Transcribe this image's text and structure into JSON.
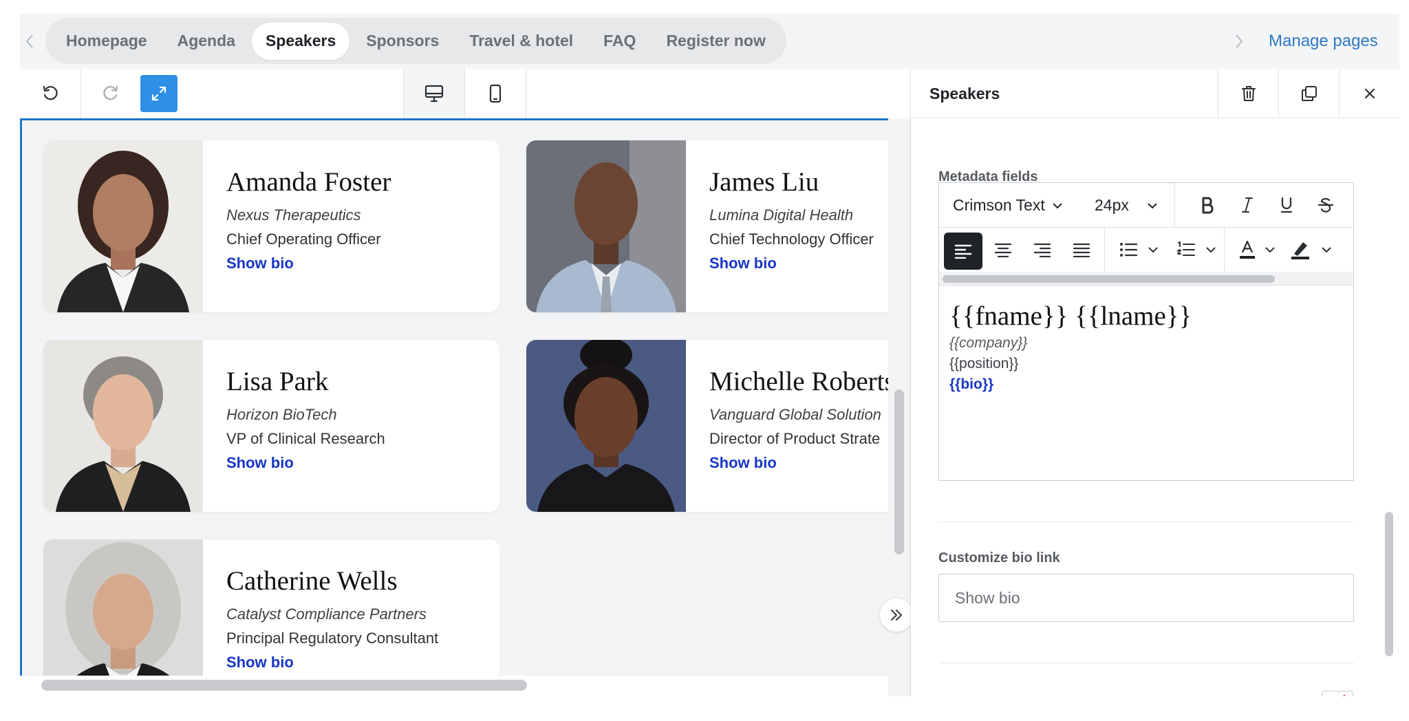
{
  "topnav": {
    "tabs": [
      {
        "label": "Homepage"
      },
      {
        "label": "Agenda"
      },
      {
        "label": "Speakers",
        "active": true
      },
      {
        "label": "Sponsors"
      },
      {
        "label": "Travel & hotel"
      },
      {
        "label": "FAQ"
      },
      {
        "label": "Register now"
      }
    ],
    "manage_pages": "Manage pages"
  },
  "toolbar": {
    "undo_icon": "undo-icon",
    "redo_icon": "redo-icon",
    "fullscreen_icon": "expand-icon",
    "desktop_icon": "desktop-icon",
    "mobile_icon": "mobile-icon"
  },
  "speakers": [
    {
      "name": "Amanda Foster",
      "company": "Nexus Therapeutics",
      "position": "Chief Operating Officer",
      "bio": "Show bio"
    },
    {
      "name": "James Liu",
      "company": "Lumina Digital Health",
      "position": "Chief Technology Officer",
      "bio": "Show bio"
    },
    {
      "name": "Lisa Park",
      "company": "Horizon BioTech",
      "position": "VP of Clinical Research",
      "bio": "Show bio"
    },
    {
      "name": "Michelle Roberts",
      "company": "Vanguard Global Solution",
      "position": "Director of Product Strate",
      "bio": "Show bio"
    },
    {
      "name": "Catherine Wells",
      "company": "Catalyst Compliance Partners",
      "position": "Principal Regulatory Consultant",
      "bio": "Show bio"
    }
  ],
  "panel": {
    "title": "Speakers",
    "delete_icon": "trash-icon",
    "duplicate_icon": "copy-icon",
    "close_icon": "close-icon",
    "metadata_label": "Metadata fields",
    "font_family": "Crimson Text",
    "font_size": "24px",
    "template": {
      "name": "{{fname}} {{lname}}",
      "company": "{{company}}",
      "position": "{{position}}",
      "bio": "{{bio}}"
    },
    "bio_link_label": "Customize bio link",
    "bio_link_value": "Show bio"
  },
  "colors": {
    "accent": "#1d74c9",
    "link": "#1736c6",
    "manage_link": "#2e79c8",
    "expand_button": "#2e8fe6"
  }
}
